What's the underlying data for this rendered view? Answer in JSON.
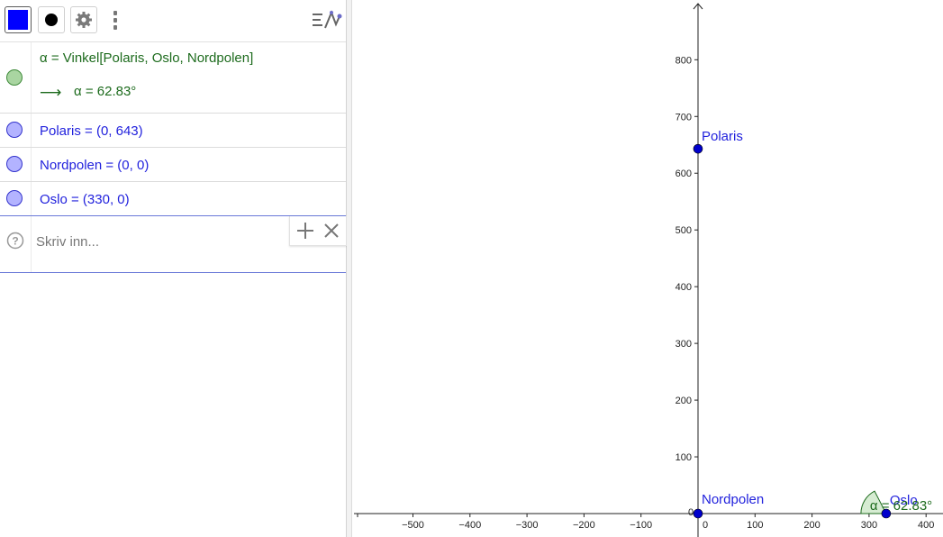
{
  "toolbar": {
    "color_value": "#0000ff",
    "style_icon": "point-style-icon",
    "settings_icon": "gear-icon",
    "more_icon": "vertical-dots-icon",
    "view_icon": "algebra-graphics-view-icon"
  },
  "algebra": {
    "rows": [
      {
        "label": "α = Vinkel[Polaris, Oslo, Nordpolen]",
        "output_arrow": "⟶",
        "output": "α = 62.83°",
        "color": "#1d6b1d"
      },
      {
        "label": "Polaris = (0, 643)",
        "color": "#2222dd"
      },
      {
        "label": "Nordpolen = (0, 0)",
        "color": "#2222dd"
      },
      {
        "label": "Oslo = (330, 0)",
        "color": "#2222dd"
      }
    ],
    "input": {
      "placeholder": "Skriv inn...",
      "help_icon": "help-icon",
      "add_icon": "plus-icon",
      "close_icon": "close-icon"
    }
  },
  "graphics": {
    "x_ticks": [
      "−500",
      "−400",
      "−300",
      "−200",
      "−100",
      "0",
      "100",
      "200",
      "300",
      "400"
    ],
    "y_ticks": [
      "100",
      "200",
      "300",
      "400",
      "500",
      "600",
      "700",
      "800"
    ],
    "origin_label": "0",
    "points": [
      {
        "name": "Polaris",
        "x": 0,
        "y": 643
      },
      {
        "name": "Nordpolen",
        "x": 0,
        "y": 0
      },
      {
        "name": "Oslo",
        "x": 330,
        "y": 0
      }
    ],
    "angle_label": "α = 62.83°",
    "point_color": "#0000cc",
    "angle_color": "#1d6b1d"
  }
}
